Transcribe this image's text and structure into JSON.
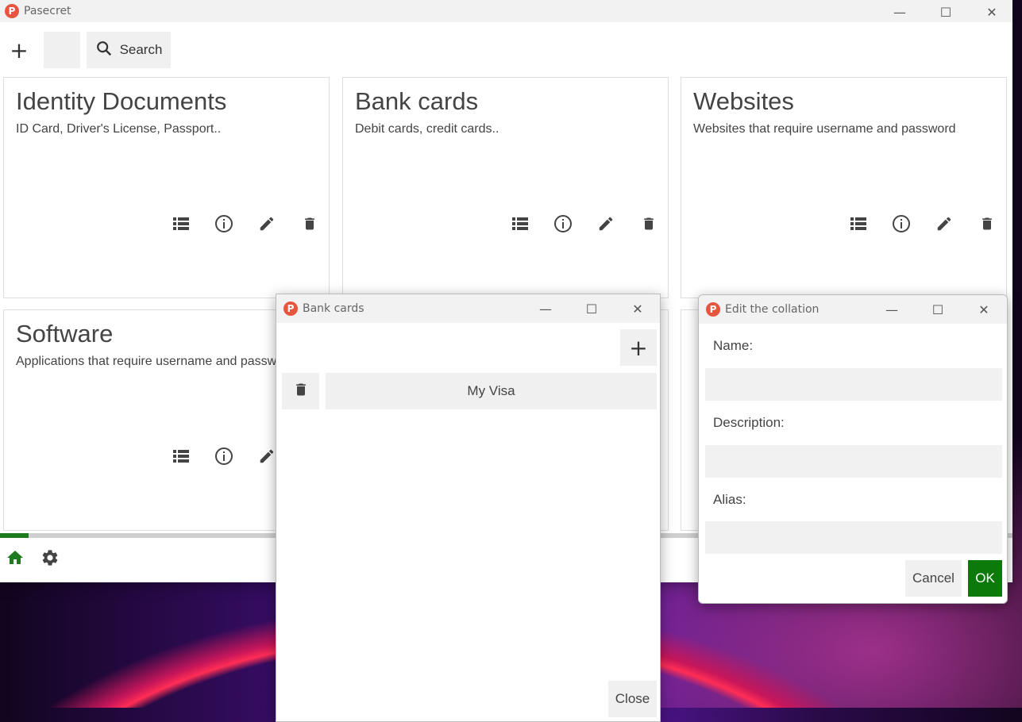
{
  "main_window": {
    "title": "Pasecret",
    "controls": {
      "minimize": "—",
      "maximize": "☐",
      "close": "✕"
    },
    "toolbar": {
      "add_label": "+",
      "search_label": "Search"
    },
    "cards": [
      {
        "title": "Identity Documents",
        "description": "ID Card, Driver's License, Passport.."
      },
      {
        "title": "Bank cards",
        "description": "Debit cards, credit cards.."
      },
      {
        "title": "Websites",
        "description": "Websites that require username and password"
      },
      {
        "title": "Software",
        "description": "Applications that require username and password"
      }
    ],
    "card_actions": [
      "list-icon",
      "info-icon",
      "edit-icon",
      "delete-icon"
    ],
    "progress_fraction": 0.028,
    "bottom_nav": [
      "home-icon",
      "settings-icon"
    ],
    "accent_color": "#1e7a1e"
  },
  "bank_window": {
    "title": "Bank cards",
    "add_label": "+",
    "items": [
      {
        "label": "My Visa"
      }
    ],
    "close_label": "Close"
  },
  "edit_dialog": {
    "title": "Edit the collation",
    "name_label": "Name:",
    "description_label": "Description:",
    "alias_label": "Alias:",
    "name_value": "",
    "description_value": "",
    "alias_value": "",
    "cancel_label": "Cancel",
    "ok_label": "OK",
    "ok_color": "#0b7a0b"
  }
}
